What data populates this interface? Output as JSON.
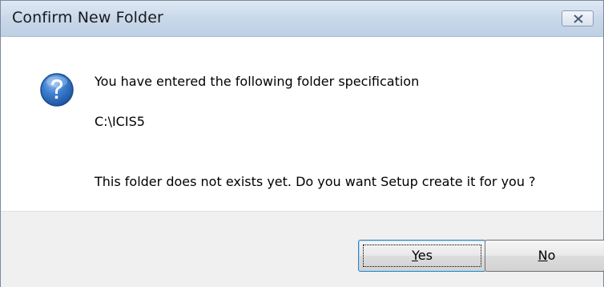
{
  "window": {
    "title": "Confirm New Folder"
  },
  "message": {
    "line1": "You have entered the following folder specification",
    "path": "C:\\ICIS5",
    "line3": "This folder does not exists yet.  Do you want Setup create it for you ?"
  },
  "buttons": {
    "yes_first": "Y",
    "yes_rest": "es",
    "no_first": "N",
    "no_rest": "o"
  },
  "icons": {
    "close": "close-icon",
    "question": "question-icon"
  },
  "colors": {
    "question_icon": "#2a67b8",
    "titlebar": "#c9d8ea",
    "footer": "#f0f0f0"
  }
}
